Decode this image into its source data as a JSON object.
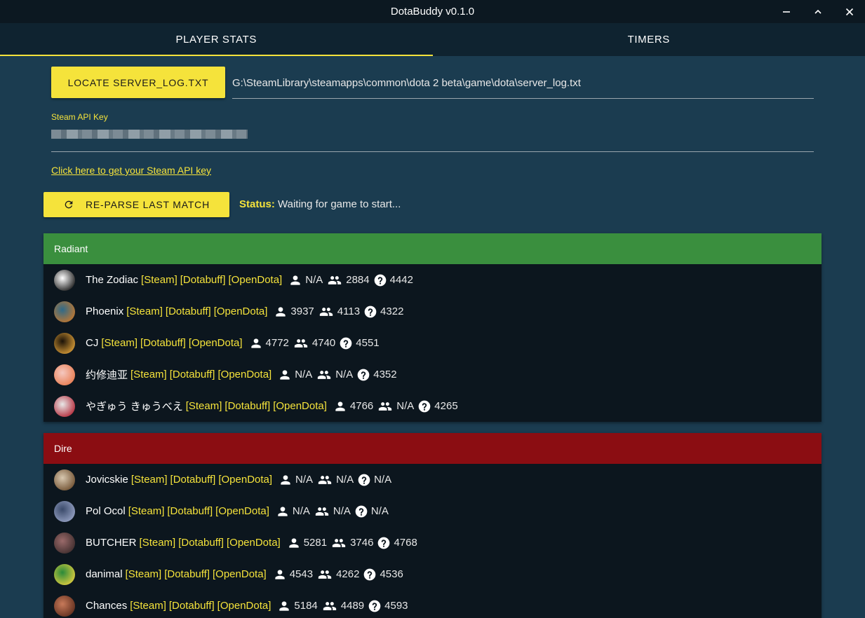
{
  "window": {
    "title": "DotaBuddy v0.1.0"
  },
  "tabs": [
    {
      "label": "PLAYER STATS",
      "active": true
    },
    {
      "label": "TIMERS",
      "active": false
    }
  ],
  "config": {
    "locate_button": "LOCATE SERVER_LOG.TXT",
    "log_path": "G:\\SteamLibrary\\steamapps\\common\\dota 2 beta\\game\\dota\\server_log.txt",
    "api_key_label": "Steam API Key",
    "api_key_link": "Click here to get your Steam API key"
  },
  "actions": {
    "reparse_button": "RE-PARSE LAST MATCH",
    "status_label": "Status:",
    "status_text": "Waiting for game to start..."
  },
  "link_labels": {
    "steam": "[Steam]",
    "dotabuff": "[Dotabuff]",
    "opendota": "[OpenDota]"
  },
  "colors": {
    "accent": "#f5e33b",
    "radiant": "#3a8f3e",
    "dire": "#8b0d12",
    "background": "#1b3c50"
  },
  "teams": [
    {
      "name": "Radiant",
      "players": [
        {
          "name": "The Zodiac",
          "solo": "N/A",
          "party": "2884",
          "estimate": "4442",
          "avatar": [
            "#ffffff",
            "#111111"
          ]
        },
        {
          "name": "Phoenix",
          "solo": "3937",
          "party": "4113",
          "estimate": "4322",
          "avatar": [
            "#2e6a8a",
            "#c8782a"
          ]
        },
        {
          "name": "CJ",
          "solo": "4772",
          "party": "4740",
          "estimate": "4551",
          "avatar": [
            "#1a1208",
            "#e0a23a"
          ]
        },
        {
          "name": "约修迪亚",
          "solo": "N/A",
          "party": "N/A",
          "estimate": "4352",
          "avatar": [
            "#f4c8c0",
            "#e8784a"
          ]
        },
        {
          "name": "やぎゅう きゅうべえ",
          "solo": "4766",
          "party": "N/A",
          "estimate": "4265",
          "avatar": [
            "#e8e8e8",
            "#b02030"
          ]
        }
      ]
    },
    {
      "name": "Dire",
      "players": [
        {
          "name": "Jovicskie",
          "solo": "N/A",
          "party": "N/A",
          "estimate": "N/A",
          "avatar": [
            "#d8c8b0",
            "#6a4a2a"
          ]
        },
        {
          "name": "Pol Ocol",
          "solo": "N/A",
          "party": "N/A",
          "estimate": "N/A",
          "avatar": [
            "#3a4a6a",
            "#9aa6c8"
          ]
        },
        {
          "name": "BUTCHER",
          "solo": "5281",
          "party": "3746",
          "estimate": "4768",
          "avatar": [
            "#9a6a6a",
            "#3a2a2a"
          ]
        },
        {
          "name": "danimal",
          "solo": "4543",
          "party": "4262",
          "estimate": "4536",
          "avatar": [
            "#2a8a3a",
            "#e8d040"
          ]
        },
        {
          "name": "Chances",
          "solo": "5184",
          "party": "4489",
          "estimate": "4593",
          "avatar": [
            "#c87a5a",
            "#5a2a1a"
          ]
        }
      ]
    }
  ]
}
